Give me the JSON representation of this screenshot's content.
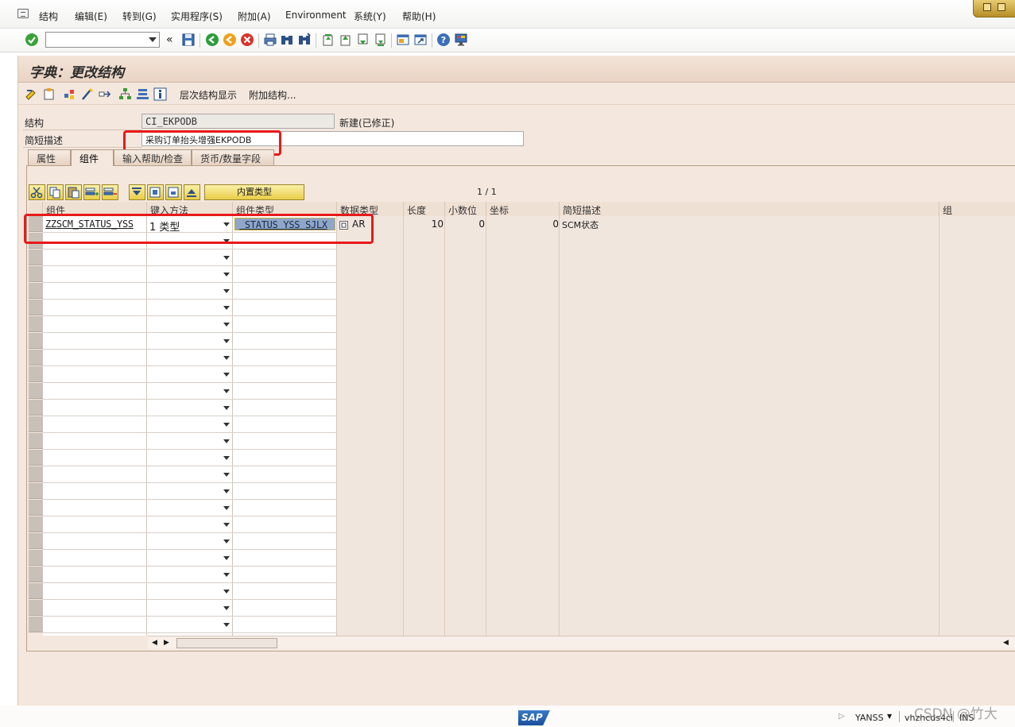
{
  "menu": {
    "items": [
      "结构",
      "编辑(E)",
      "转到(G)",
      "实用程序(S)",
      "附加(A)",
      "Environment",
      "系统(Y)",
      "帮助(H)"
    ]
  },
  "toolbar": {
    "command_field": "",
    "icons": [
      "enter-icon",
      "collapse-icon",
      "save-icon",
      "back-icon",
      "exit-icon",
      "cancel-icon",
      "print-icon",
      "find-icon",
      "find-next-icon",
      "first-page-icon",
      "previous-page-icon",
      "next-page-icon",
      "last-page-icon",
      "create-session-icon",
      "shortcut-icon",
      "help-icon",
      "customize-layout-icon"
    ]
  },
  "page": {
    "title": "字典：更改结构"
  },
  "app_toolbar": {
    "hierarchy_button": "层次结构显示",
    "append_structure_button": "附加结构..."
  },
  "form": {
    "structure_label": "结构",
    "structure_value": "CI_EKPODB",
    "status_text": "新建(已修正)",
    "short_desc_label": "简短描述",
    "short_desc_value": "采购订单抬头增强EKPODB"
  },
  "tabs": [
    "属性",
    "组件",
    "输入帮助/检查",
    "货币/数量字段"
  ],
  "active_tab": 1,
  "table": {
    "builtin_type_button": "内置类型",
    "page_counter": "1 / 1",
    "columns": [
      "组件",
      "键入方法",
      "组件类型",
      "数据类型",
      "长度",
      "小数位",
      "坐标",
      "简短描述",
      "组"
    ],
    "rows": [
      {
        "component": "ZZSCM_STATUS_YSS",
        "typing_method": "1 类型",
        "component_type": "_STATUS_YSS_SJLX",
        "data_type": "AR",
        "length": "10",
        "decimals": "0",
        "coordinate": "0",
        "short_description": "SCM状态",
        "group": ""
      }
    ]
  },
  "statusbar": {
    "logo": "SAP",
    "user": "YANSS",
    "server": "vhzhcds4ci",
    "mode": "INS"
  },
  "watermark": "CSDN @竹大"
}
